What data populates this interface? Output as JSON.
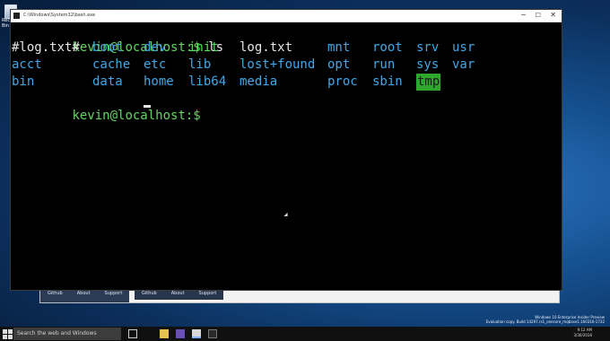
{
  "desktop": {
    "recycle_label": "Recycle Bin"
  },
  "window": {
    "title": "C:\\Windows\\System32\\bash.exe",
    "controls": {
      "minimize": "─",
      "maximize": "☐",
      "close": "✕"
    }
  },
  "terminal": {
    "prompt1": "kevin@localhost:$",
    "command1": " ls",
    "listing": [
      [
        "#log.txt#",
        "boot",
        "dev",
        "init",
        "log.txt",
        "mnt",
        "root",
        "srv",
        "usr"
      ],
      [
        "acct",
        "cache",
        "etc",
        "lib",
        "lost+found",
        "opt",
        "run",
        "sys",
        "var"
      ],
      [
        "bin",
        "data",
        "home",
        "lib64",
        "media",
        "",
        "proc",
        "sbin",
        "tmp"
      ]
    ],
    "prompt2": "kevin@localhost:$"
  },
  "background_window": {
    "links": [
      "Github",
      "About",
      "Support"
    ],
    "links2": [
      "Github",
      "About",
      "Support"
    ]
  },
  "taskbar": {
    "search_placeholder": "Search the web and Windows",
    "time": "9:12 AM",
    "date": "3/30/2016"
  },
  "watermark": {
    "line1": "Windows 10 Enterprise Insider Preview",
    "line2": "Evaluation copy. Build 14297.rs1_onecore_mqbase1.160316-1732"
  },
  "colors": {
    "prompt": "#5fd75f",
    "directory": "#40a8e8",
    "link": "#4ce34c",
    "file": "#e6e6e6",
    "tmp_highlight": "#2fa72f"
  },
  "icons": {
    "start": "windows-start-icon",
    "task_view": "task-view-icon",
    "explorer": "folder-icon",
    "vs": "visual-studio-icon",
    "terminal": "terminal-icon"
  }
}
